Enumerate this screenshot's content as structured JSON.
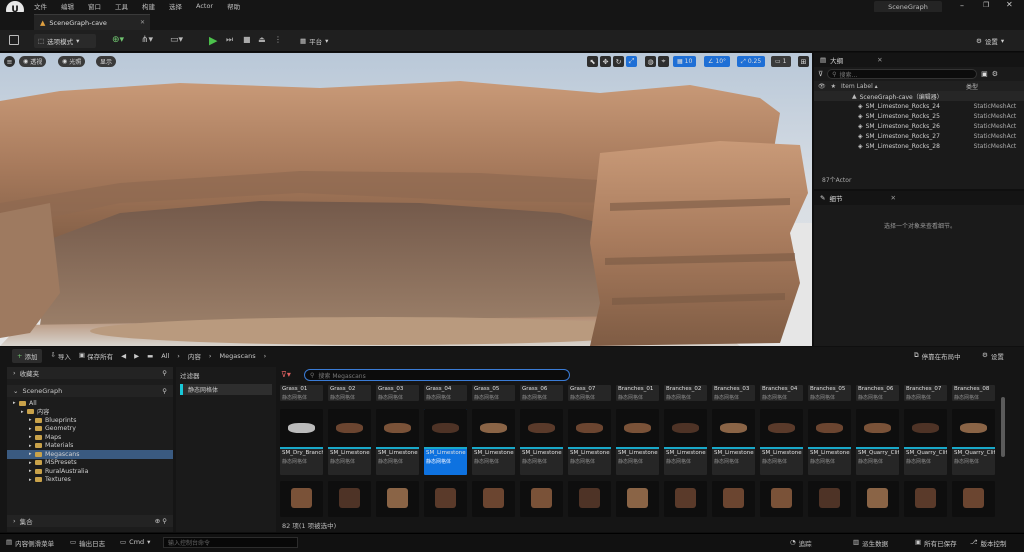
{
  "app": {
    "logo": "unreal-logo",
    "menu": [
      "文件",
      "编辑",
      "窗口",
      "工具",
      "构建",
      "选择",
      "Actor",
      "帮助"
    ],
    "project_name": "SceneGraph",
    "tab": "SceneGraph-cave"
  },
  "toolbar": {
    "mode": "选项模式",
    "platform": "平台",
    "settings": "设置"
  },
  "viewport": {
    "perspective": "透视",
    "lit": "光照",
    "show": "显示",
    "grid": "10",
    "angle": "10°",
    "scale": "0.25",
    "camera": "1"
  },
  "outliner": {
    "title": "大纲",
    "search_placeholder": "搜索...",
    "col_label": "Item Label ▴",
    "col_type": "类型",
    "root": "SceneGraph-cave（编辑器）",
    "rows": [
      {
        "label": "SM_Limestone_Rocks_24",
        "type": "StaticMeshAct"
      },
      {
        "label": "SM_Limestone_Rocks_25",
        "type": "StaticMeshAct"
      },
      {
        "label": "SM_Limestone_Rocks_26",
        "type": "StaticMeshAct"
      },
      {
        "label": "SM_Limestone_Rocks_27",
        "type": "StaticMeshAct"
      },
      {
        "label": "SM_Limestone_Rocks_28",
        "type": "StaticMeshAct"
      }
    ],
    "count": "87个Actor"
  },
  "details": {
    "title": "细节",
    "empty": "选择一个对象来查看细节。"
  },
  "content": {
    "add": "添加",
    "import": "导入",
    "save_all": "保存所有",
    "path": [
      "All",
      "内容",
      "Megascans"
    ],
    "dock": "停靠在布局中",
    "settings": "设置",
    "favorites": "收藏夹",
    "project": "SceneGraph",
    "filters_title": "过滤器",
    "filter_chip": "静态网格体",
    "search_placeholder": "搜索 Megascans",
    "collections": "集合",
    "item_count": "82 项(1 项被选中)",
    "tree": [
      {
        "label": "All",
        "indent": 0
      },
      {
        "label": "内容",
        "indent": 1
      },
      {
        "label": "Blueprints",
        "indent": 2
      },
      {
        "label": "Geometry",
        "indent": 2
      },
      {
        "label": "Maps",
        "indent": 2
      },
      {
        "label": "Materials",
        "indent": 2
      },
      {
        "label": "Megascans",
        "indent": 2,
        "selected": true
      },
      {
        "label": "MSPresets",
        "indent": 2
      },
      {
        "label": "RuralAustralia",
        "indent": 2
      },
      {
        "label": "Textures",
        "indent": 2
      }
    ],
    "row1": [
      "Grass_01",
      "Grass_02",
      "Grass_03",
      "Grass_04",
      "Grass_05",
      "Grass_06",
      "Grass_07",
      "Branches_01",
      "Branches_02",
      "Branches_03",
      "Branches_04",
      "Branches_05",
      "Branches_06",
      "Branches_07",
      "Branches_08"
    ],
    "row2": [
      "SM_Dry_Branches_08",
      "SM_Limestone",
      "SM_Limestone",
      "SM_Limestone",
      "SM_Limestone",
      "SM_Limestone",
      "SM_Limestone",
      "SM_Limestone",
      "SM_Limestone",
      "SM_Limestone",
      "SM_Limestone",
      "SM_Limestone",
      "SM_Quarry_Cliff_01",
      "SM_Quarry_Cliff_02",
      "SM_Quarry_Cliff_03"
    ],
    "asset_type": "静态网格体"
  },
  "status": {
    "drawer": "内容侧滑菜单",
    "log": "输出日志",
    "cmd": "Cmd",
    "cmd_placeholder": "输入控制台命令",
    "trace": "追踪",
    "derived": "派生数据",
    "saved": "所有已保存",
    "source": "版本控制"
  }
}
